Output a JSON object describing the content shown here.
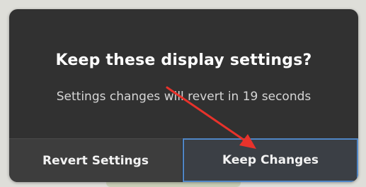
{
  "dialog": {
    "title": "Keep these display settings?",
    "message": "Settings changes will revert in 19 seconds"
  },
  "buttons": {
    "revert_label": "Revert Settings",
    "keep_label": "Keep Changes"
  },
  "annotation": {
    "arrow_color": "#e8322b"
  }
}
